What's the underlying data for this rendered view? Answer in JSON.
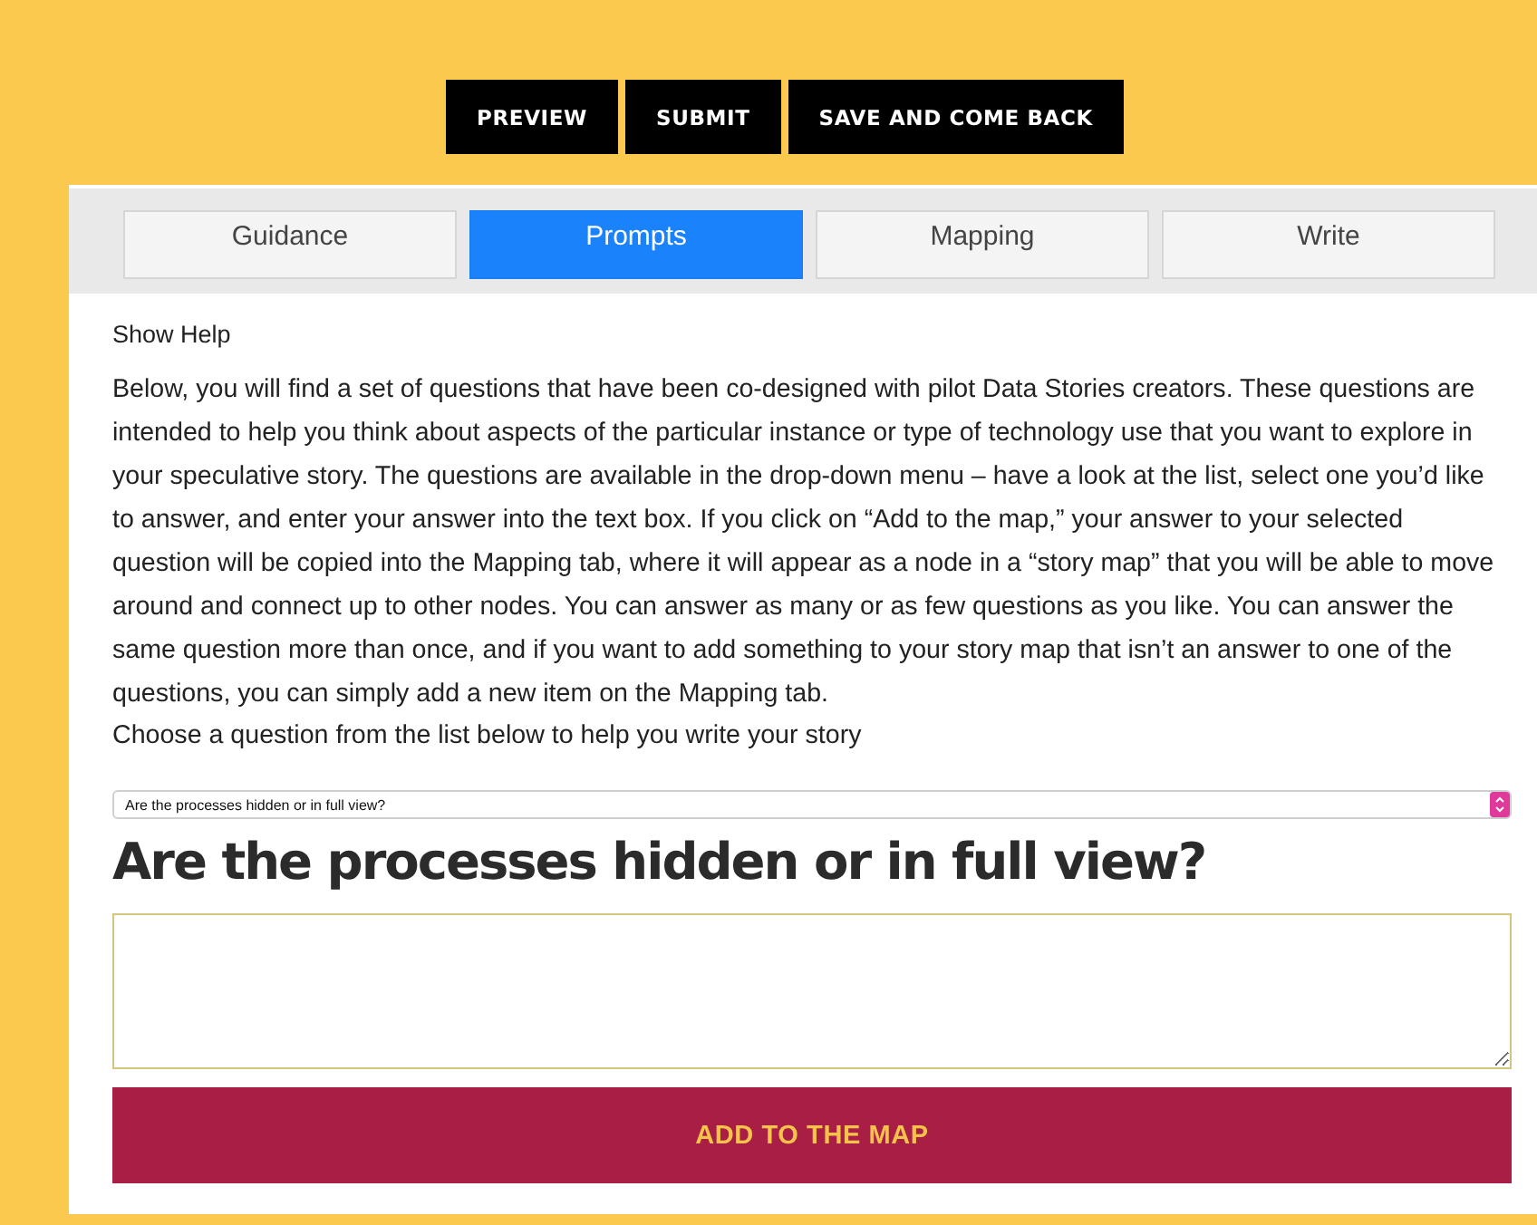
{
  "actions": [
    "PREVIEW",
    "SUBMIT",
    "SAVE AND COME BACK"
  ],
  "tabs": [
    {
      "label": "Guidance",
      "selected": false
    },
    {
      "label": "Prompts",
      "selected": true
    },
    {
      "label": "Mapping",
      "selected": false
    },
    {
      "label": "Write",
      "selected": false
    }
  ],
  "help_toggle": "Show Help",
  "intro": "Below, you will find a set of questions that have been co-designed with pilot Data Stories creators. These questions are intended to help you think about aspects of the particular instance or type of technology use that you want to explore in your speculative story. The questions are available in the drop-down menu – have a look at the list, select one you’d like to answer, and enter your answer into the text box. If you click on “Add to the map,” your answer to your selected question will be copied into the Mapping tab, where it will appear as a node in a “story map” that you will be able to move around and connect up to other nodes.   You can answer as many or as few questions as you like. You can answer the same question more than once, and if you want to add something to your story map that isn’t an answer to one of the questions, you can simply add a new item on the Mapping tab.",
  "choose_label": "Choose a question from the list below to help you write your story",
  "question_select": {
    "value": "Are the processes hidden or in full view?"
  },
  "question_heading": "Are the processes hidden or in full view?",
  "add_button": "ADD TO THE MAP"
}
